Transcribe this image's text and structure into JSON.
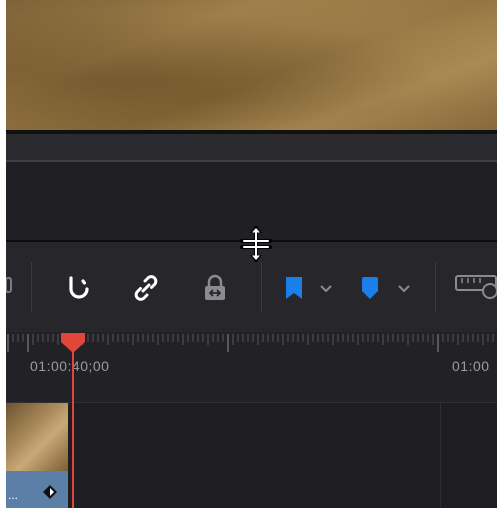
{
  "timeline": {
    "timecode_current": "01:00:40;00",
    "timecode_next": "01:00"
  },
  "clip": {
    "label": "..."
  },
  "toolbar": {
    "icons": [
      "snapping-icon",
      "link-icon",
      "position-lock-icon",
      "flag-icon",
      "marker-icon",
      "zoom-icon"
    ]
  },
  "colors": {
    "playhead": "#e0463a",
    "flag": "#1a7fe8",
    "marker": "#1a7fe8",
    "clip_label_bg": "#5b7fa6"
  }
}
